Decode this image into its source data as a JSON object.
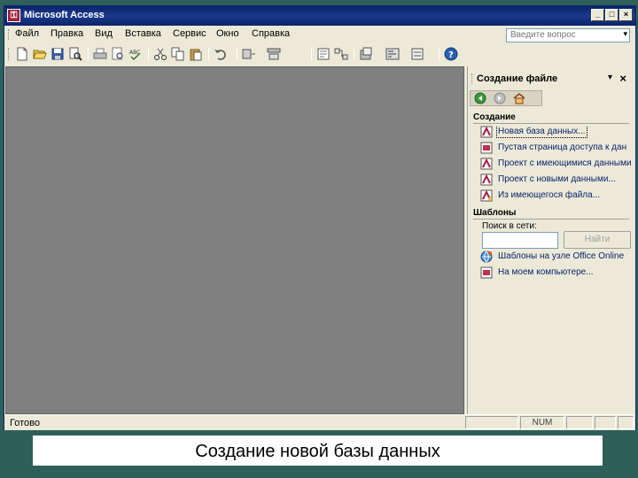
{
  "window": {
    "title": "Microsoft Access",
    "app_icon": "access-key-icon",
    "controls": [
      "minimize-icon",
      "maximize-icon",
      "close-icon"
    ]
  },
  "menubar": {
    "items": [
      {
        "label": "Файл"
      },
      {
        "label": "Правка"
      },
      {
        "label": "Вид"
      },
      {
        "label": "Вставка"
      },
      {
        "label": "Сервис"
      },
      {
        "label": "Окно"
      },
      {
        "label": "Справка"
      }
    ],
    "ask_placeholder": "Введите вопрос"
  },
  "toolbar": {
    "icons": [
      "new-icon",
      "open-icon",
      "save-icon",
      "search-file-icon",
      "print-icon",
      "print-preview-icon",
      "spelling-icon",
      "cut-icon",
      "copy-icon",
      "paste-icon",
      "undo-icon",
      "office-links-icon",
      "analyze-icon",
      "properties-icon",
      "relationships-icon",
      "new-object-icon",
      "code-icon",
      "help-icon"
    ]
  },
  "taskpane": {
    "title": "Создание файле",
    "nav": [
      "back-icon",
      "forward-icon",
      "home-icon"
    ],
    "create_heading": "Создание",
    "create_links": [
      {
        "label": "Новая база данных...",
        "icon": "new-database-icon"
      },
      {
        "label": "Пустая страница доступа к дан",
        "icon": "blank-page-icon"
      },
      {
        "label": "Проект с имеющимися данными",
        "icon": "project-existing-icon"
      },
      {
        "label": "Проект с новыми данными...",
        "icon": "project-new-icon"
      },
      {
        "label": "Из имеющегося файла...",
        "icon": "from-file-icon"
      }
    ],
    "templates_heading": "Шаблоны",
    "search_label": "Поиск в сети:",
    "search_value": "",
    "find_button": "Найти",
    "template_links": [
      {
        "label": "Шаблоны на узле Office Online",
        "icon": "office-online-icon"
      },
      {
        "label": "На моем компьютере...",
        "icon": "my-computer-icon"
      }
    ]
  },
  "statusbar": {
    "text": "Готово",
    "num": "NUM"
  },
  "caption": "Создание новой базы данных",
  "colors": {
    "titlebar": "#0a246a",
    "desktop": "#2f5f5b",
    "workspace": "#808080",
    "chrome": "#ece9d8",
    "link": "#0a246a"
  }
}
